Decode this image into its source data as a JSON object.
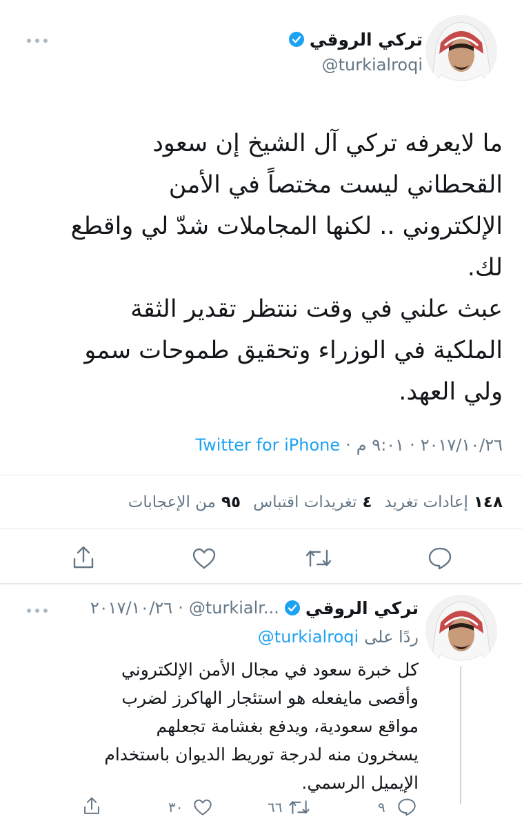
{
  "tweet": {
    "display_name": "تركي الروقي",
    "handle": "@turkialroqi",
    "text_lines": [
      "ما لايعرفه تركي آل الشيخ إن سعود",
      "القحطاني ليست مختصاً في الأمن",
      "الإلكتروني .. لكنها المجاملات شدّ لي واقطع",
      "لك.",
      "عبث علني في وقت ننتظر تقدير الثقة",
      "الملكية في الوزراء وتحقيق طموحات سمو",
      "ولي العهد."
    ],
    "meta": {
      "date": "٢٠١٧/١٠/٢٦",
      "separator": "·",
      "time": "٩:٠١ م",
      "source": "Twitter for iPhone"
    },
    "stats": {
      "retweets_count": "١٤٨",
      "retweets_label": "إعادات تغريد",
      "quotes_count": "٤",
      "quotes_label": "تغريدات اقتباس",
      "likes_count": "٩٥",
      "likes_label": "من الإعجابات"
    }
  },
  "reply": {
    "display_name": "تركي الروقي",
    "handle": "@turkialr...",
    "date": "٢٠١٧/١٠/٢٦",
    "replying_prefix": "ردًا على",
    "replying_to": "@turkialroqi",
    "text_lines": [
      "كل خبرة سعود في مجال الأمن الإلكتروني",
      "وأقصى مايفعله هو استئجار الهاكرز لضرب",
      "مواقع سعودية، ويدفع بغشامة تجعلهم",
      "يسخرون منه لدرجة توريط الديوان باستخدام",
      "الإيميل الرسمي."
    ],
    "counts": {
      "replies": "٩",
      "retweets": "٦٦",
      "likes": "٣٠"
    }
  },
  "icons": {
    "more": "more-icon",
    "verified": "verified-badge-icon",
    "reply": "reply-icon",
    "retweet": "retweet-icon",
    "like": "heart-icon",
    "share": "share-icon"
  },
  "colors": {
    "accent": "#1da1f2",
    "muted": "#657786",
    "divider": "#e1e8ed",
    "text": "#14171a"
  }
}
